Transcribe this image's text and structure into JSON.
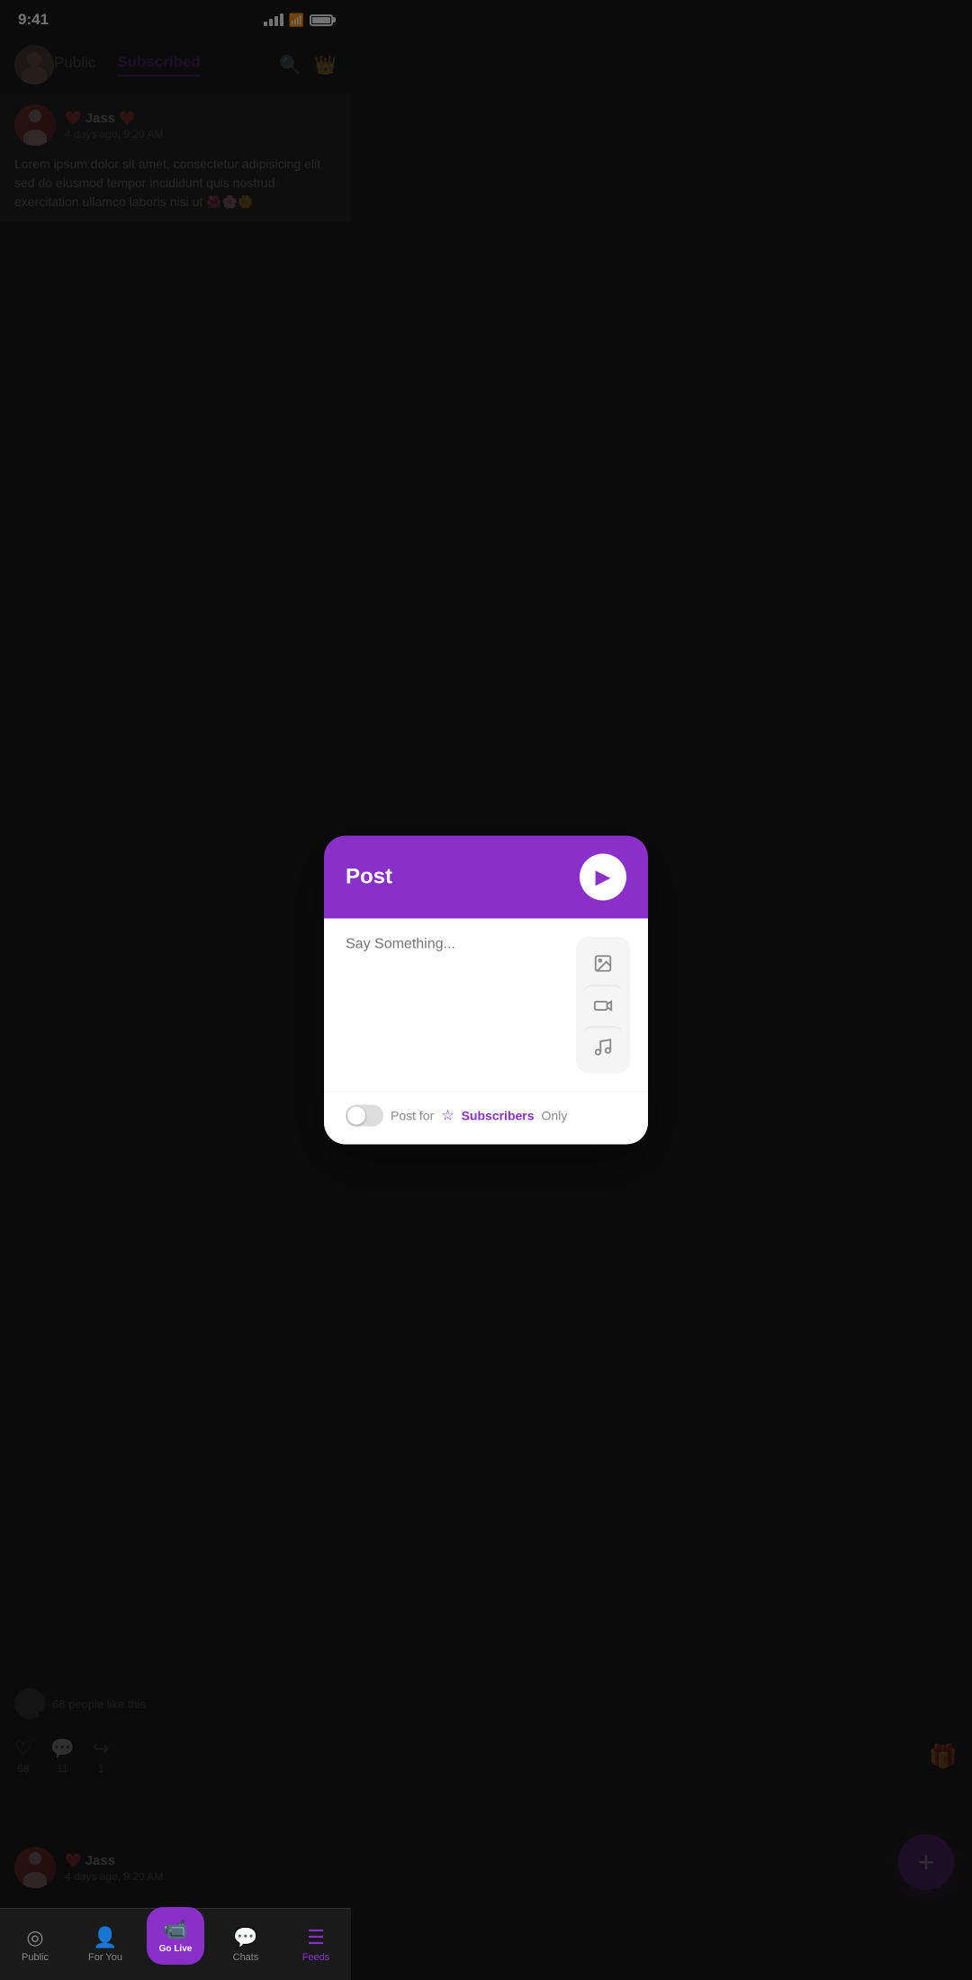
{
  "statusBar": {
    "time": "9:41",
    "signal": "signal",
    "wifi": "wifi",
    "battery": "battery"
  },
  "header": {
    "tabs": [
      {
        "id": "public",
        "label": "Public",
        "active": false
      },
      {
        "id": "subscribed",
        "label": "Subscribed",
        "active": true
      }
    ],
    "searchLabel": "search",
    "crownLabel": "premium"
  },
  "feedPost": {
    "authorName": "Jass",
    "heartLeft": "❤️",
    "heartRight": "❤️",
    "postTime": "4 days ago, 9:20 AM",
    "postText": "Lorem ipsum dolor sit amet, consectetur adipisicing elit, sed do eiusmod tempor incididunt  quis nostrud exercitation ullamco laboris nisi ut 🌺🌸🌼"
  },
  "modal": {
    "title": "Post",
    "sendLabel": "▶",
    "placeholder": "Say Something...",
    "imageToolLabel": "image",
    "videoToolLabel": "video",
    "musicToolLabel": "music",
    "toggleLabel": "Post for",
    "subscribersLabel": "Subscribers",
    "onlyLabel": "Only"
  },
  "reactions": {
    "count": "68 people like this"
  },
  "postActions": [
    {
      "icon": "♡",
      "count": "68",
      "label": "likes"
    },
    {
      "icon": "💬",
      "count": "11",
      "label": "comments"
    },
    {
      "icon": "↪",
      "count": "1",
      "label": "shares"
    }
  ],
  "secondPost": {
    "authorName": "Jass",
    "postTime": "4 days ago, 9:20 AM"
  },
  "bottomNav": [
    {
      "id": "public",
      "icon": "◎",
      "label": "Public",
      "active": false
    },
    {
      "id": "foryou",
      "icon": "👤",
      "label": "For You",
      "active": false
    },
    {
      "id": "golive",
      "icon": "📹",
      "label": "Go Live",
      "active": false,
      "isCenter": true
    },
    {
      "id": "chats",
      "icon": "💬",
      "label": "Chats",
      "active": false
    },
    {
      "id": "feeds",
      "icon": "☰",
      "label": "Feeds",
      "active": true
    }
  ]
}
